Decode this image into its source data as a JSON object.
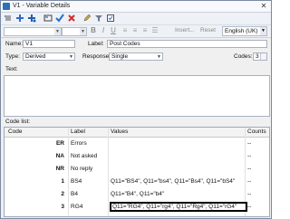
{
  "window": {
    "title": "V1 - Variable Details",
    "close_symbol": "✕"
  },
  "toolbar": {
    "icons": [
      "row-insert-icon",
      "add-icon",
      "add-multiple-icon",
      "view-icon",
      "check-icon",
      "cross-icon",
      "edit-icon",
      "filter-icon",
      "checkbox-icon"
    ],
    "insert_label": "Insert...",
    "reset_label": "Reset",
    "language": "English (UK)"
  },
  "form": {
    "name_label": "Name:",
    "name_value": "V1",
    "label_label": "Label:",
    "label_value": "Post Codes",
    "type_label": "Type:",
    "type_value": "Derived",
    "response_label": "Response:",
    "response_value": "Single",
    "codes_label": "Codes:",
    "codes_value": "3",
    "text_label": "Text:"
  },
  "code_list": {
    "section_label": "Code list:",
    "headers": {
      "code": "Code",
      "label": "Label",
      "values": "Values",
      "counts": "Counts"
    },
    "rows": [
      {
        "code": "ER",
        "label": "Errors",
        "values": "",
        "counts": "--"
      },
      {
        "code": "NA",
        "label": "Not asked",
        "values": "",
        "counts": "--"
      },
      {
        "code": "NR",
        "label": "No reply",
        "values": "",
        "counts": "--"
      },
      {
        "code": "1",
        "label": "BS4",
        "values": "Q11=\"BS4\", Q11=\"bs4\", Q11=\"Bs4\", Q11=\"bS4\"",
        "counts": "--"
      },
      {
        "code": "2",
        "label": "B4",
        "values": "Q11=\"B4\", Q11=\"b4\"",
        "counts": "--"
      },
      {
        "code": "3",
        "label": "RG4",
        "values": "Q11=\"RG4\", Q11=\"rg4\", Q11=\"Rg4\", Q11=\"rG4\"",
        "counts": "--"
      }
    ]
  }
}
